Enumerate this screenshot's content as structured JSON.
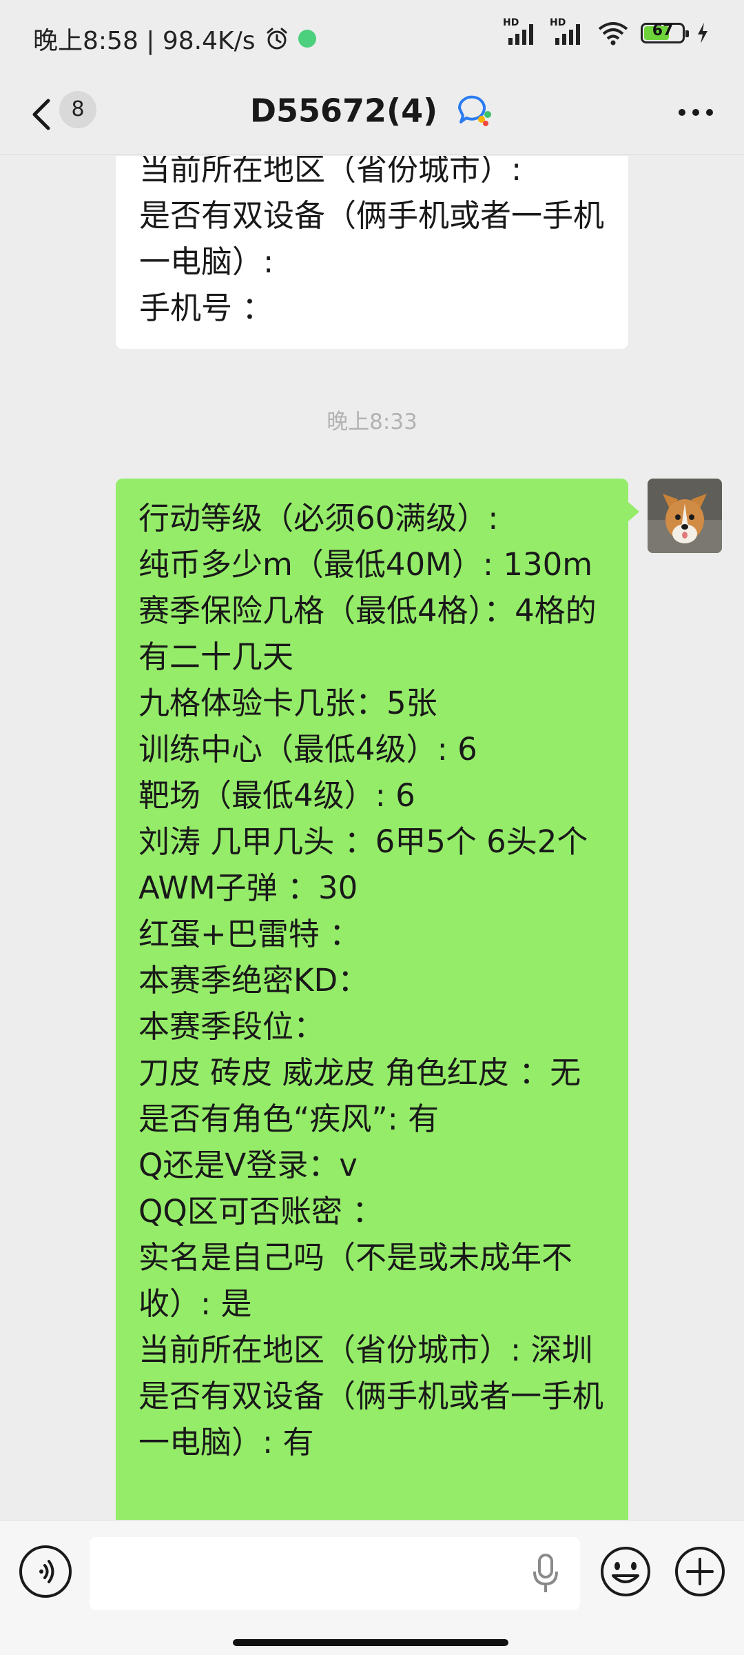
{
  "status_bar": {
    "time_speed": "晚上8:58 | 98.4K/s",
    "signal_label_1": "HD",
    "signal_label_2": "HD",
    "battery": "67",
    "battery_level": 0.67
  },
  "header": {
    "unread_count": "8",
    "title": "D55672(4)"
  },
  "chat": {
    "prev_message": "当前所在地区（省份城市）:\n是否有双设备（俩手机或者一手机一电脑）:\n手机号 ：",
    "timestamp": "晚上8:33",
    "my_message": "行动等级（必须60满级）:\n纯币多少m（最低40M）: 130m\n赛季保险几格（最低4格）：4格的有二十几天\n九格体验卡几张：5张\n训练中心（最低4级）: 6\n靶场（最低4级）: 6\n刘涛 几甲几头 ：6甲5个 6头2个\nAWM子弹 ：30\n红蛋+巴雷特 ：\n本赛季绝密KD：\n本赛季段位：\n刀皮 砖皮 威龙皮 角色红皮 ：无\n是否有角色“疾风”: 有\nQ还是V登录：v\nQQ区可否账密 ：\n实名是自己吗（不是或未成年不收）: 是\n当前所在地区（省份城市）: 深圳\n是否有双设备（俩手机或者一手机一电脑）: 有"
  },
  "input_bar": {
    "placeholder": ""
  },
  "colors": {
    "background": "#ededed",
    "my_bubble": "#95ec69",
    "other_bubble": "#ffffff",
    "timestamp": "#b2b2b2"
  },
  "icons": [
    "alarm-icon",
    "app-notification-icon",
    "signal-icon",
    "wifi-icon",
    "battery-icon",
    "charging-icon",
    "back-icon",
    "group-chat-icon",
    "more-icon",
    "voice-icon",
    "mic-icon",
    "emoji-icon",
    "plus-icon"
  ]
}
